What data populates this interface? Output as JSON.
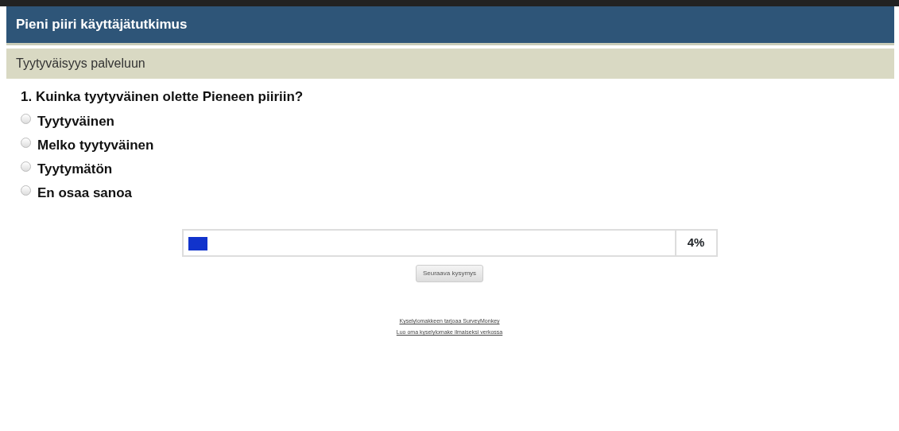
{
  "header": {
    "title": "Pieni piiri käyttäjätutkimus"
  },
  "section": {
    "title": "Tyytyväisyys palveluun"
  },
  "question": {
    "text": "1. Kuinka tyytyväinen olette Pieneen piiriin?",
    "options": [
      {
        "label": "Tyytyväinen",
        "selected": false
      },
      {
        "label": "Melko tyytyväinen",
        "selected": false
      },
      {
        "label": "Tyytymätön",
        "selected": false
      },
      {
        "label": "En osaa sanoa",
        "selected": false
      }
    ]
  },
  "progress": {
    "level": 0.04,
    "reading": "4%"
  },
  "next_button": "Seuraava kysymys",
  "footer_links": [
    "Kyselylomakkeen tarjoaa SurveyMonkey",
    "Luo oma kyselylomake ilmaiseksi verkossa"
  ]
}
